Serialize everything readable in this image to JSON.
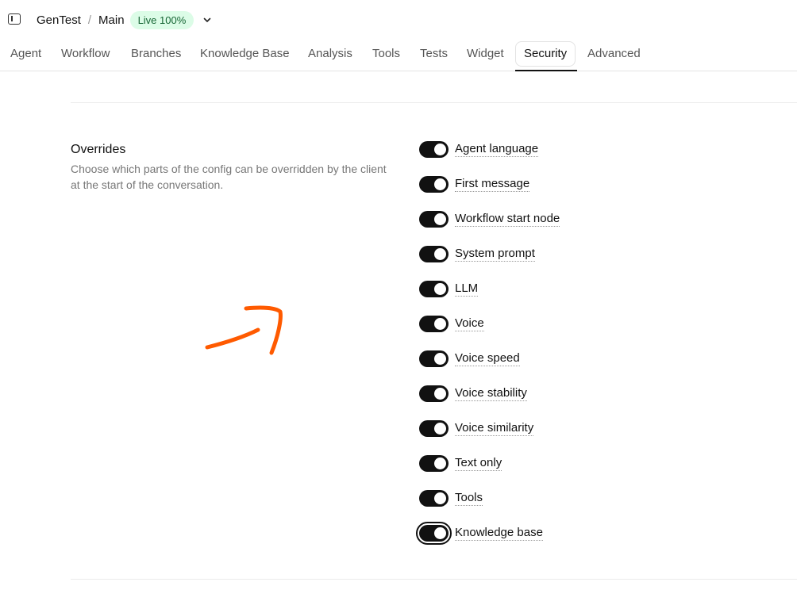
{
  "header": {
    "project": "GenTest",
    "separator": "/",
    "branch": "Main",
    "status_badge": "Live 100%"
  },
  "tabs": [
    {
      "label": "Agent"
    },
    {
      "label": "Workflow"
    },
    {
      "label": "Branches"
    },
    {
      "label": "Knowledge Base"
    },
    {
      "label": "Analysis"
    },
    {
      "label": "Tools"
    },
    {
      "label": "Tests"
    },
    {
      "label": "Widget"
    },
    {
      "label": "Security",
      "active": true
    },
    {
      "label": "Advanced"
    }
  ],
  "overrides": {
    "title": "Overrides",
    "description": "Choose which parts of the config can be overridden by the client at the start of the conversation.",
    "items": [
      {
        "label": "Agent language",
        "enabled": true
      },
      {
        "label": "First message",
        "enabled": true
      },
      {
        "label": "Workflow start node",
        "enabled": true
      },
      {
        "label": "System prompt",
        "enabled": true
      },
      {
        "label": "LLM",
        "enabled": true
      },
      {
        "label": "Voice",
        "enabled": true
      },
      {
        "label": "Voice speed",
        "enabled": true
      },
      {
        "label": "Voice stability",
        "enabled": true
      },
      {
        "label": "Voice similarity",
        "enabled": true
      },
      {
        "label": "Text only",
        "enabled": true
      },
      {
        "label": "Tools",
        "enabled": true
      },
      {
        "label": "Knowledge base",
        "enabled": true,
        "focused": true
      }
    ]
  },
  "colors": {
    "toggle_on": "#111111",
    "badge_bg": "#dcfce7",
    "badge_text": "#166534",
    "annotation": "#ff5a00"
  },
  "icons": {
    "sidebar_toggle": "sidebar-toggle-icon",
    "chevron": "chevron-down-icon"
  }
}
